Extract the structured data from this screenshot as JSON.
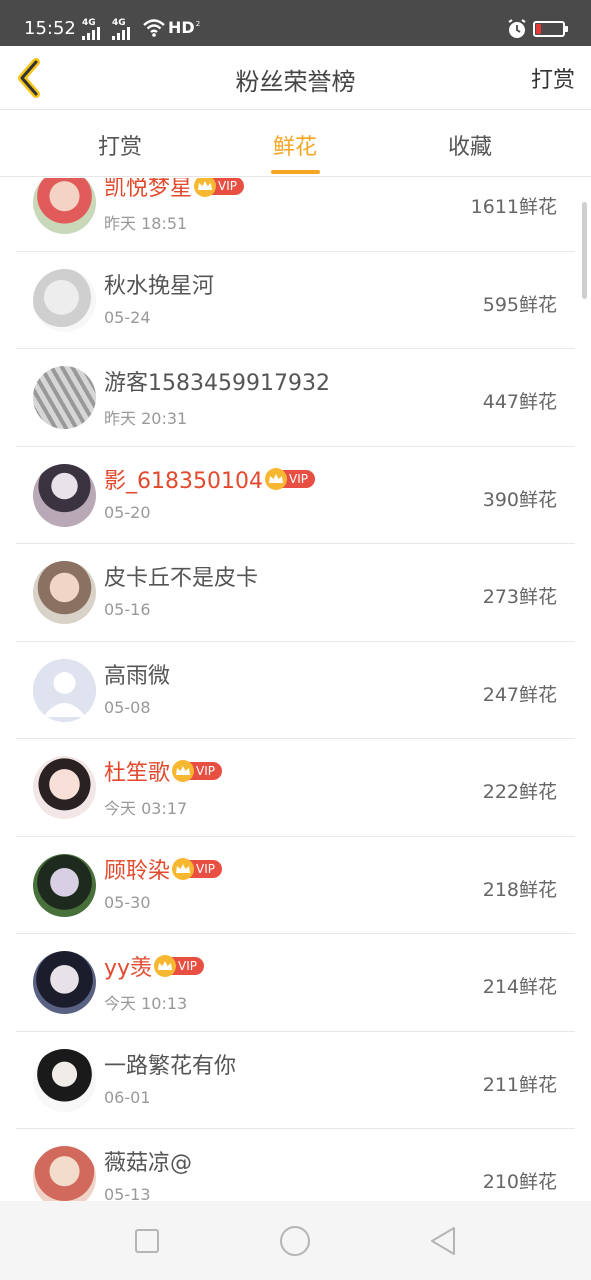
{
  "status_bar": {
    "time": "15:52",
    "signal_1": "4G",
    "signal_2": "4G",
    "hd": "HD",
    "hd_sub": "2"
  },
  "header": {
    "title": "粉丝荣誉榜",
    "action": "打赏"
  },
  "tabs": [
    {
      "label": "打赏",
      "active": false
    },
    {
      "label": "鲜花",
      "active": true
    },
    {
      "label": "收藏",
      "active": false
    }
  ],
  "vip_label": "VIP",
  "entries": [
    {
      "name": "凯悦梦星",
      "vip": true,
      "time": "昨天 18:51",
      "count": "1611鲜花"
    },
    {
      "name": "秋水挽星河",
      "vip": false,
      "time": "05-24",
      "count": "595鲜花"
    },
    {
      "name": "游客1583459917932",
      "vip": false,
      "time": "昨天 20:31",
      "count": "447鲜花"
    },
    {
      "name": "影_618350104",
      "vip": true,
      "time": "05-20",
      "count": "390鲜花"
    },
    {
      "name": "皮卡丘不是皮卡",
      "vip": false,
      "time": "05-16",
      "count": "273鲜花"
    },
    {
      "name": "高雨微",
      "vip": false,
      "time": "05-08",
      "count": "247鲜花"
    },
    {
      "name": "杜笙歌",
      "vip": true,
      "time": "今天 03:17",
      "count": "222鲜花"
    },
    {
      "name": "顾聆染",
      "vip": true,
      "time": "05-30",
      "count": "218鲜花"
    },
    {
      "name": "yy羡",
      "vip": true,
      "time": "今天 10:13",
      "count": "214鲜花"
    },
    {
      "name": "一路繁花有你",
      "vip": false,
      "time": "06-01",
      "count": "211鲜花"
    },
    {
      "name": "薇菇凉@",
      "vip": false,
      "time": "05-13",
      "count": "210鲜花"
    }
  ],
  "colors": {
    "accent": "#f5a623",
    "vip_name": "#e24a2e",
    "vip_tag": "#e84f42",
    "crown": "#f7b731"
  }
}
